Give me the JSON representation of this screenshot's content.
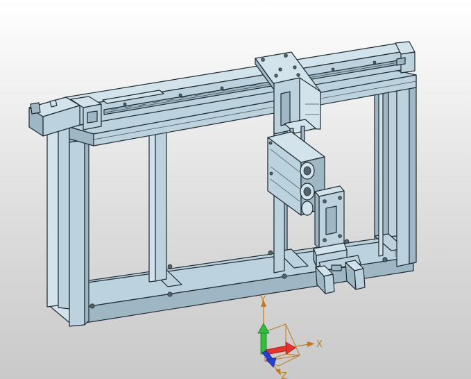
{
  "viewport": {
    "background_top": "#ffffff",
    "background_bottom": "#c9c9c9",
    "model_color": "#bcd2de",
    "edge_color": "#1d2a31"
  },
  "triad": {
    "x_label": "X",
    "y_label": "Y",
    "z_label": "Z",
    "x_color": "#e8312a",
    "y_color": "#2fc03a",
    "z_color": "#2340d8",
    "label_color": "#c07a1a"
  }
}
